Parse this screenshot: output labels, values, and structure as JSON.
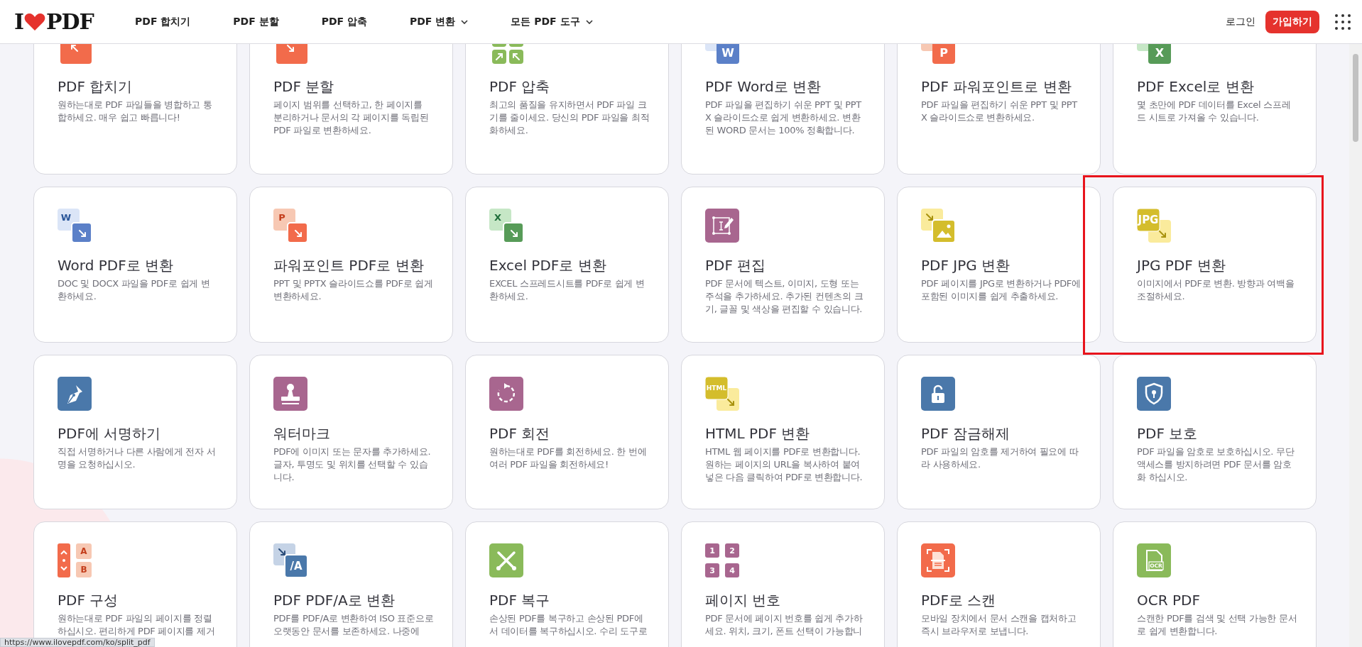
{
  "header": {
    "logo": {
      "left": "I",
      "right": "PDF"
    },
    "nav": [
      {
        "label": "PDF 합치기",
        "has_menu": false
      },
      {
        "label": "PDF 분할",
        "has_menu": false
      },
      {
        "label": "PDF 압축",
        "has_menu": false
      },
      {
        "label": "PDF 변환",
        "has_menu": true
      },
      {
        "label": "모든 PDF 도구",
        "has_menu": true
      }
    ],
    "login": "로그인",
    "signup": "가입하기"
  },
  "tools": [
    {
      "title": "PDF 합치기",
      "description": "원하는대로 PDF 파일들을 병합하고 통합하세요. 매우 쉽고 빠릅니다!",
      "highlighted": false
    },
    {
      "title": "PDF 분할",
      "description": "페이지 범위를 선택하고, 한 페이지를 분리하거나 문서의 각 페이지를 독립된 PDF 파일로 변환하세요.",
      "highlighted": false
    },
    {
      "title": "PDF 압축",
      "description": "최고의 품질을 유지하면서 PDF 파일 크기를 줄이세요. 당신의 PDF 파일을 최적화하세요.",
      "highlighted": false
    },
    {
      "title": "PDF Word로 변환",
      "description": "PDF 파일을 편집하기 쉬운 PPT 및 PPTX 슬라이드쇼로 쉽게 변환하세요. 변환된 WORD 문서는 100% 정확합니다.",
      "icon_labels": [
        "W"
      ],
      "highlighted": false
    },
    {
      "title": "PDF 파워포인트로 변환",
      "description": "PDF 파일을 편집하기 쉬운 PPT 및 PPTX 슬라이드쇼로 변환하세요.",
      "icon_labels": [
        "P"
      ],
      "highlighted": false
    },
    {
      "title": "PDF Excel로 변환",
      "description": "몇 초만에 PDF 데이터를 Excel 스프레드 시트로 가져올 수 있습니다.",
      "icon_labels": [
        "X"
      ],
      "highlighted": false
    },
    {
      "title": "Word PDF로 변환",
      "description": "DOC 및 DOCX 파일을 PDF로 쉽게 변환하세요.",
      "icon_labels": [
        "W"
      ],
      "highlighted": false
    },
    {
      "title": "파워포인트 PDF로 변환",
      "description": "PPT 및 PPTX 슬라이드쇼를 PDF로 쉽게 변환하세요.",
      "icon_labels": [
        "P"
      ],
      "highlighted": false
    },
    {
      "title": "Excel PDF로 변환",
      "description": "EXCEL 스프레드시트를 PDF로 쉽게 변환하세요.",
      "icon_labels": [
        "X"
      ],
      "highlighted": false
    },
    {
      "title": "PDF 편집",
      "description": "PDF 문서에 텍스트, 이미지, 도형 또는 주석을 추가하세요. 추가된 컨텐츠의 크기, 글꼴 및 색상을 편집할 수 있습니다.",
      "highlighted": false
    },
    {
      "title": "PDF JPG 변환",
      "description": "PDF 페이지를 JPG로 변환하거나 PDF에 포함된 이미지를 쉽게 추출하세요.",
      "highlighted": false
    },
    {
      "title": "JPG PDF 변환",
      "description": "이미지에서 PDF로 변환. 방향과 여백을 조절하세요.",
      "icon_labels": [
        "JPG"
      ],
      "highlighted": true
    },
    {
      "title": "PDF에 서명하기",
      "description": "직접 서명하거나 다른 사람에게 전자 서명을 요청하십시오.",
      "highlighted": false
    },
    {
      "title": "워터마크",
      "description": "PDF에 이미지 또는 문자를 추가하세요. 글자, 투명도 및 위치를 선택할 수 있습니다.",
      "highlighted": false
    },
    {
      "title": "PDF 회전",
      "description": "원하는대로 PDF를 회전하세요. 한 번에 여러 PDF 파일을 회전하세요!",
      "highlighted": false
    },
    {
      "title": "HTML PDF 변환",
      "description": "HTML 웹 페이지를 PDF로 변환합니다. 원하는 페이지의 URL을 복사하여 붙여넣은 다음 클릭하여 PDF로 변환합니다.",
      "icon_labels": [
        "HTML"
      ],
      "highlighted": false
    },
    {
      "title": "PDF 잠금해제",
      "description": "PDF 파일의 암호를 제거하여 필요에 따라 사용하세요.",
      "highlighted": false
    },
    {
      "title": "PDF 보호",
      "description": "PDF 파일을 암호로 보호하십시오. 무단 액세스를 방지하려면 PDF 문서를 암호화 하십시오.",
      "highlighted": false
    },
    {
      "title": "PDF 구성",
      "description": "원하는대로 PDF 파일의 페이지를 정렬하십시오. 편리하게 PDF 페이지를 제거",
      "icon_labels": [
        "A",
        "B"
      ],
      "highlighted": false
    },
    {
      "title": "PDF PDF/A로 변환",
      "description": "PDF를 PDF/A로 변환하여 ISO 표준으로 오랫동안 문서를 보존하세요. 나중에",
      "icon_labels": [
        "/A"
      ],
      "highlighted": false
    },
    {
      "title": "PDF 복구",
      "description": "손상된 PDF를 복구하고 손상된 PDF에서 데이터를 복구하십시오. 수리 도구로",
      "highlighted": false
    },
    {
      "title": "페이지 번호",
      "description": "PDF 문서에 페이지 번호를 쉽게 추가하세요. 위치, 크기, 폰트 선택이 가능합니",
      "icon_labels": [
        "1",
        "2",
        "3",
        "4"
      ],
      "highlighted": false
    },
    {
      "title": "PDF로 스캔",
      "description": "모바일 장치에서 문서 스캔을 캡처하고 즉시 브라우저로 보냅니다.",
      "highlighted": false
    },
    {
      "title": "OCR PDF",
      "description": "스캔한 PDF를 검색 및 선택 가능한 문서로 쉽게 변환합니다.",
      "icon_labels": [
        "OCR"
      ],
      "highlighted": false
    }
  ],
  "status_url": "https://www.ilovepdf.com/ko/split_pdf"
}
